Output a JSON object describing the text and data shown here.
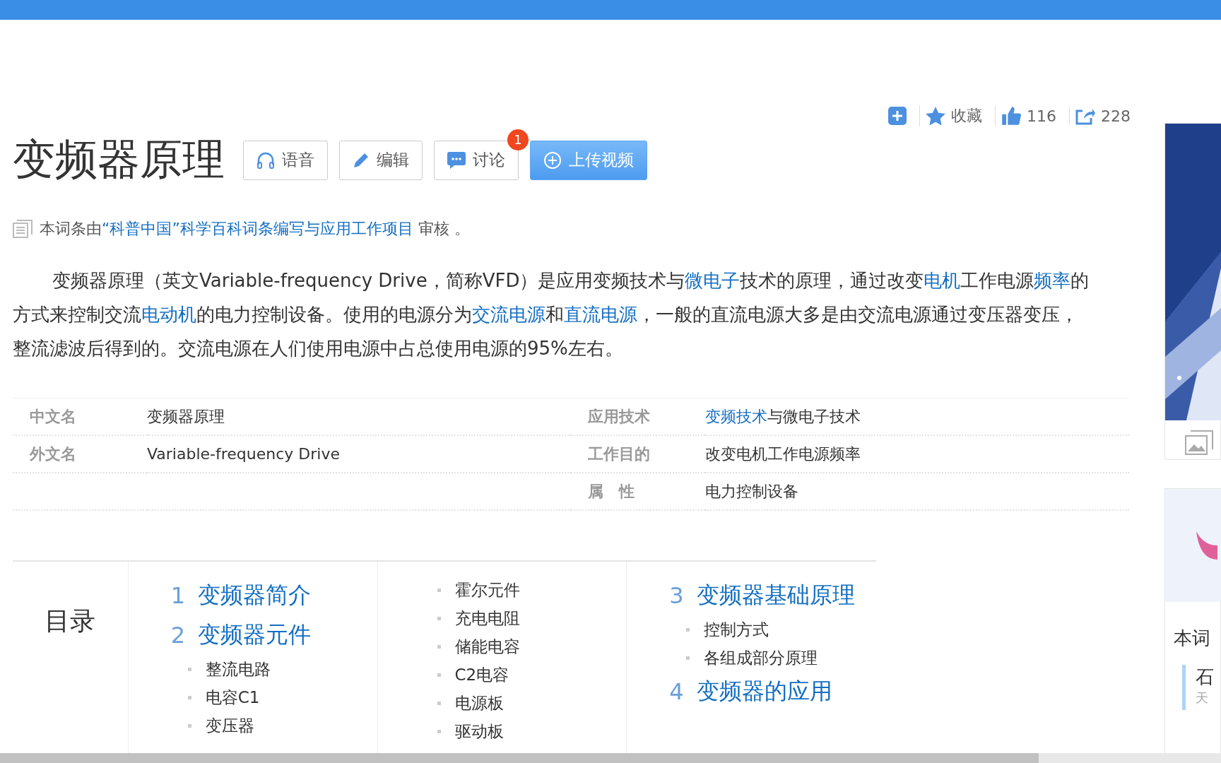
{
  "actions": [
    {
      "kind": "add"
    },
    {
      "kind": "star",
      "label": "收藏"
    },
    {
      "kind": "like",
      "label": "116"
    },
    {
      "kind": "share",
      "label": "228"
    }
  ],
  "title": "变频器原理",
  "buttons": [
    {
      "kind": "voice",
      "label": "语音"
    },
    {
      "kind": "edit",
      "label": "编辑"
    },
    {
      "kind": "discuss",
      "label": "讨论",
      "badge": "1"
    },
    {
      "kind": "upload",
      "label": "上传视频"
    }
  ],
  "review": "本词条由**“科普中国”科学百科词条编写与应用工作项目** 审核 。",
  "summary": [
    {
      "text": "变频器原理（英文Variable-frequency Drive，简称VFD）是应用变频技术与"
    },
    {
      "text": "微电子",
      "link": true
    },
    {
      "text": "技术的原理，通过改变"
    },
    {
      "text": "电机",
      "link": true
    },
    {
      "text": "工作电源"
    },
    {
      "text": "频率",
      "link": true
    },
    {
      "text": "的方式来控制交流"
    },
    {
      "text": "电动机",
      "link": true
    },
    {
      "text": "的电力控制设备。使用的电源分为"
    },
    {
      "text": "交流电源",
      "link": true
    },
    {
      "text": "和"
    },
    {
      "text": "直流电源",
      "link": true
    },
    {
      "text": "，一般的直流电源大多是由交流电源通过变压器变压，整流滤波后得到的。交流电源在人们使用电源中占总使用电源的95%左右。"
    }
  ],
  "basic_info": [
    {
      "left": {
        "name": "中文名",
        "value": "变频器原理"
      },
      "right": {
        "name": "应用技术",
        "value": "**变频技术**与微电子技术"
      }
    },
    {
      "left": {
        "name": "外文名",
        "value": "Variable-frequency Drive"
      },
      "right": {
        "name": "工作目的",
        "value": "改变电机工作电源频率"
      }
    },
    {
      "right": {
        "name": "属　性",
        "value": "电力控制设备"
      }
    }
  ],
  "toc": {
    "title": "目录",
    "columns": [
      [
        {
          "kind": "level1",
          "number": "1",
          "label": "变频器简介"
        },
        {
          "kind": "level1",
          "number": "2",
          "label": "变频器元件"
        },
        {
          "kind": "level2",
          "label": "整流电路"
        },
        {
          "kind": "level2",
          "label": "电容C1"
        },
        {
          "kind": "level2",
          "label": "变压器"
        }
      ],
      [
        {
          "kind": "level2",
          "label": "霍尔元件"
        },
        {
          "kind": "level2",
          "label": "充电电阻"
        },
        {
          "kind": "level2",
          "label": "储能电容"
        },
        {
          "kind": "level2",
          "label": "C2电容"
        },
        {
          "kind": "level2",
          "label": "电源板"
        },
        {
          "kind": "level2",
          "label": "驱动板"
        }
      ],
      [
        {
          "kind": "level1",
          "number": "3",
          "label": "变频器基础原理"
        },
        {
          "kind": "level2",
          "label": "控制方式"
        },
        {
          "kind": "level2",
          "label": "各组成部分原理"
        },
        {
          "kind": "level1",
          "number": "4",
          "label": "变频器的应用"
        }
      ]
    ]
  },
  "sidebar": {
    "lower_title": "本词",
    "lower_item": "石",
    "lower_sub": "天"
  }
}
